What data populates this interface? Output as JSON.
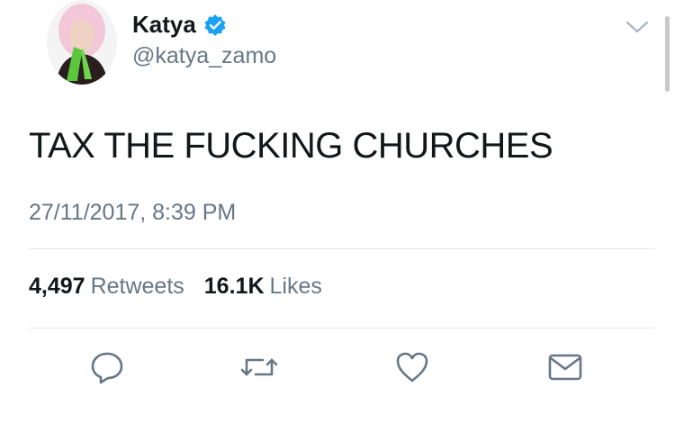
{
  "author": {
    "display_name": "Katya",
    "handle": "@katya_zamo",
    "verified_icon": "verified-badge-icon",
    "avatar_icon": "avatar-image"
  },
  "tweet": {
    "text": "TAX THE FUCKING CHURCHES",
    "timestamp": "27/11/2017, 8:39 PM"
  },
  "stats": {
    "retweets_count": "4,497",
    "retweets_label": "Retweets",
    "likes_count": "16.1K",
    "likes_label": "Likes"
  },
  "actions": [
    "reply-icon",
    "retweet-icon",
    "like-icon",
    "share-icon"
  ],
  "colors": {
    "text": "#14171a",
    "secondary": "#657786",
    "verified": "#1da1f2",
    "divider": "#e1e8ed"
  }
}
